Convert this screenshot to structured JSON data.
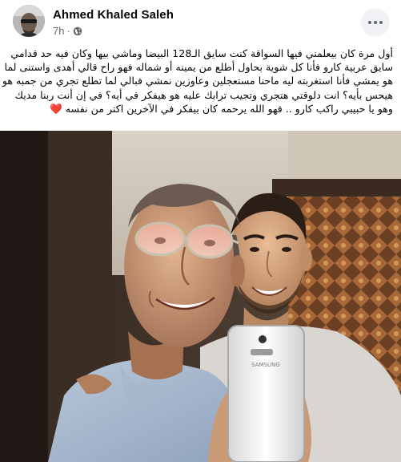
{
  "post": {
    "author": "Ahmed Khaled Saleh",
    "time": "7h",
    "separator": "·",
    "privacy_icon": "globe-icon",
    "more_icon": "more-options-icon",
    "text_lines": [
      "أول مرة كان بيعلمني فيها السواقة كنت سايق الـ128 البيضا وماشي بيها وكان فيه حد قدامي",
      "سايق عربية كارو فأنا كل شوية بحاول أطلع من يمينه أو شماله فهو راح قالي أهدى واستنى لما",
      "هو يمشي فأنا استغربته ليه ماحنا مستعجلين وعاوزين نمشي فبالي لما تطلع تجري من جمبه هو",
      "هيحس بأيه؟ انت دلوقتي هتجري وتجيب ترابك عليه هو هيفكر في أيه؟ في إن أنت ربنا مديك",
      "وهو يا حبيبي راكب كارو .. فهو الله يرحمه كان بيفكر في الآخرين اكتر من نفسه"
    ],
    "heart_emoji": "❤️"
  },
  "photo": {
    "phone_brand": "SAMSUNG"
  }
}
